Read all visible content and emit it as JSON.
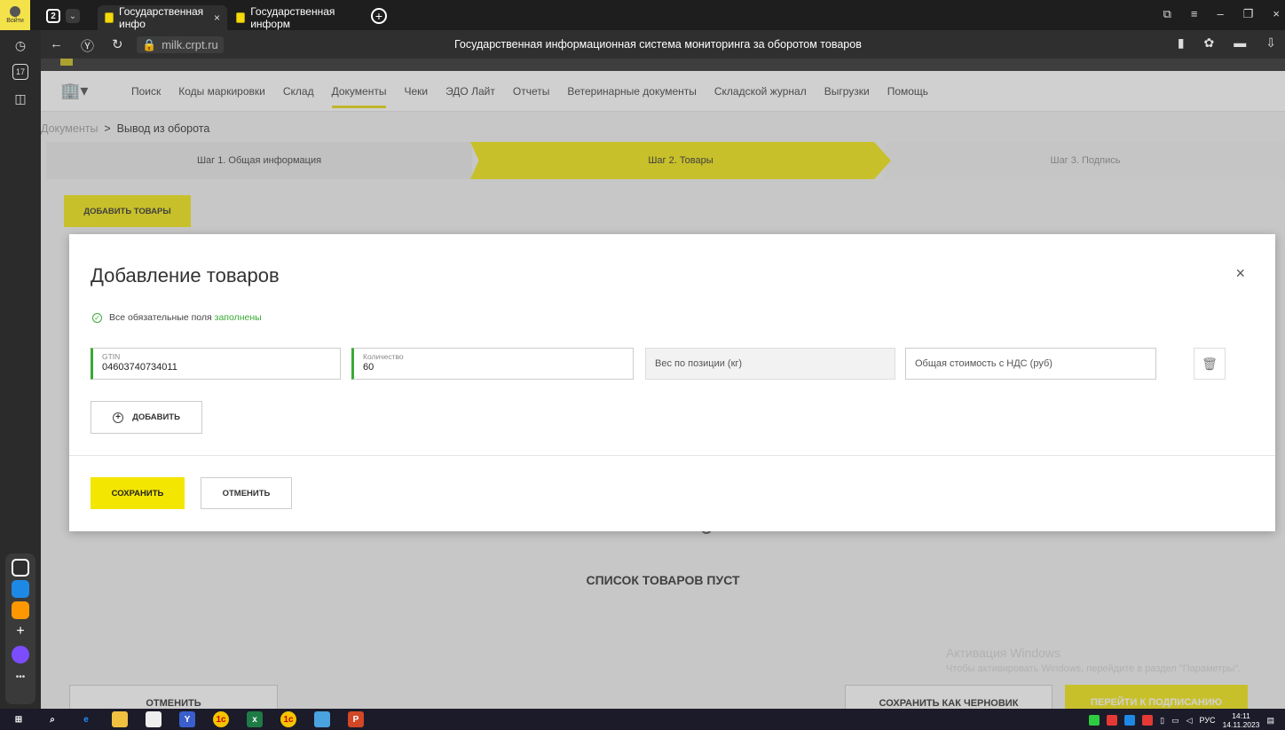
{
  "browser": {
    "login_badge": "Войти",
    "tab_count": "2",
    "tabs": [
      {
        "label": "Государственная инфо"
      },
      {
        "label": "Государственная информ"
      }
    ],
    "url": "milk.crpt.ru",
    "page_title": "Государственная информационная система мониторинга за оборотом товаров"
  },
  "site": {
    "nav": [
      "Поиск",
      "Коды маркировки",
      "Склад",
      "Документы",
      "Чеки",
      "ЭДО Лайт",
      "Отчеты",
      "Ветеринарные документы",
      "Складской журнал",
      "Выгрузки",
      "Помощь"
    ],
    "active_nav": "Документы",
    "breadcrumb": {
      "root": "Документы",
      "sep": ">",
      "current": "Вывод из оборота"
    },
    "steps": [
      "Шаг 1. Общая информация",
      "Шаг 2. Товары",
      "Шаг 3. Подпись"
    ],
    "add_goods_label": "ДОБАВИТЬ ТОВАРЫ",
    "empty_list": "СПИСОК ТОВАРОВ ПУСТ",
    "bottom_cancel": "ОТМЕНИТЬ",
    "bottom_draft": "СОХРАНИТЬ КАК ЧЕРНОВИК",
    "bottom_sign": "ПЕРЕЙТИ К ПОДПИСАНИЮ",
    "win_activate": {
      "title": "Активация Windows",
      "sub": "Чтобы активировать Windows, перейдите в раздел \"Параметры\"."
    }
  },
  "modal": {
    "title": "Добавление товаров",
    "close": "×",
    "required_text": "Все обязательные поля",
    "required_status": "заполнены",
    "fields": {
      "gtin_label": "GTIN",
      "gtin_value": "04603740734011",
      "qty_label": "Количество",
      "qty_value": "60",
      "weight_placeholder": "Вес по позиции (кг)",
      "cost_placeholder": "Общая стоимость с НДС (руб)"
    },
    "add_label": "ДОБАВИТЬ",
    "save_label": "СОХРАНИТЬ",
    "cancel_label": "ОТМЕНИТЬ"
  },
  "taskbar": {
    "lang": "РУС",
    "time": "14:11",
    "date": "14.11.2023"
  },
  "colors": {
    "accent_yellow": "#f3e600",
    "success_green": "#3aaa35"
  }
}
